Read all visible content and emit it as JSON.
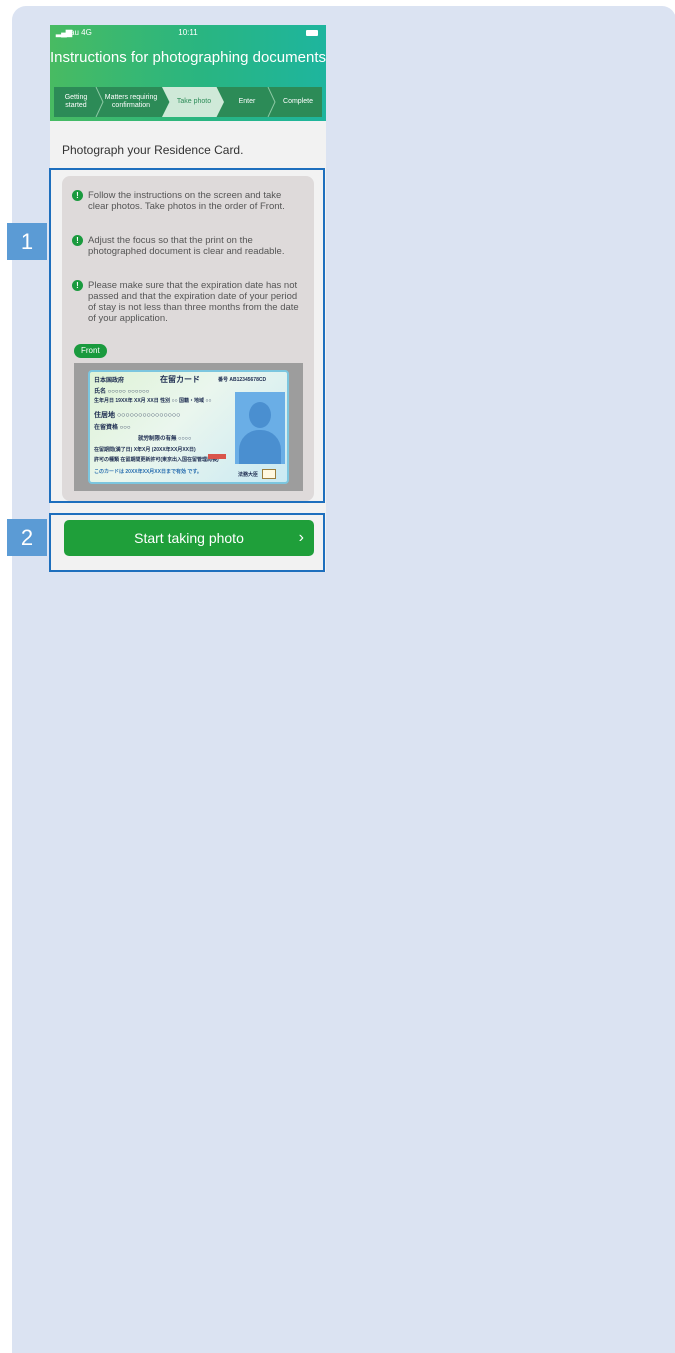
{
  "status_bar": {
    "signal": "▂▄▆",
    "carrier": "au  4G",
    "time": "10:11"
  },
  "header": {
    "title": "Instructions for photographing documents"
  },
  "steps": [
    {
      "label": "Getting started"
    },
    {
      "label": "Matters requiring confirmation"
    },
    {
      "label": "Take photo"
    },
    {
      "label": "Enter"
    },
    {
      "label": "Complete"
    }
  ],
  "body": {
    "title": "Photograph your Residence Card.",
    "instructions": [
      "Follow the instructions on the screen and take clear photos. Take photos in the order of Front.",
      "Adjust the focus so that the print on the photographed document is clear and readable.",
      "Please make sure that the expiration date has not passed and that the expiration date of your period of stay is not less than three months from the date of your application."
    ],
    "bullet_icon": "!",
    "front_label": "Front",
    "card": {
      "header_left": "日本国政府",
      "header_center": "在留カード",
      "number": "番号 AB12345678CD",
      "name_row": "氏名 ○○○○○  ○○○○○○",
      "dob_row": "生年月日 19XX年 XX月 XX日  性別 ○○  国籍・地域 ○○",
      "address_row": "住居地 ○○○○○○○○○○○○○○○",
      "status_row": "在留資格 ○○○",
      "period_row": "就労制限の有無  ○○○○",
      "expiry_row": "在留期間(満了日) X年X月 (20XX年XX月XX日)",
      "permit_row": "許可の種類 在留期間更新許可(東京出入国在留管理局長)",
      "issue_row": "このカードは 20XX年XX月XX日まで有効 です。",
      "sign_label": "法務大臣"
    },
    "start_button": "Start taking photo",
    "start_button_icon": "›"
  },
  "annotations": {
    "marker_1": "1",
    "marker_2": "2"
  },
  "colors": {
    "canvas_bg": "#dbe3f2",
    "header_green": "#29b581",
    "step_bar": "#2c8b57",
    "button_green": "#1f9f3a",
    "highlight_border": "#1e6fbd",
    "marker_bg": "#5b9bd5"
  }
}
